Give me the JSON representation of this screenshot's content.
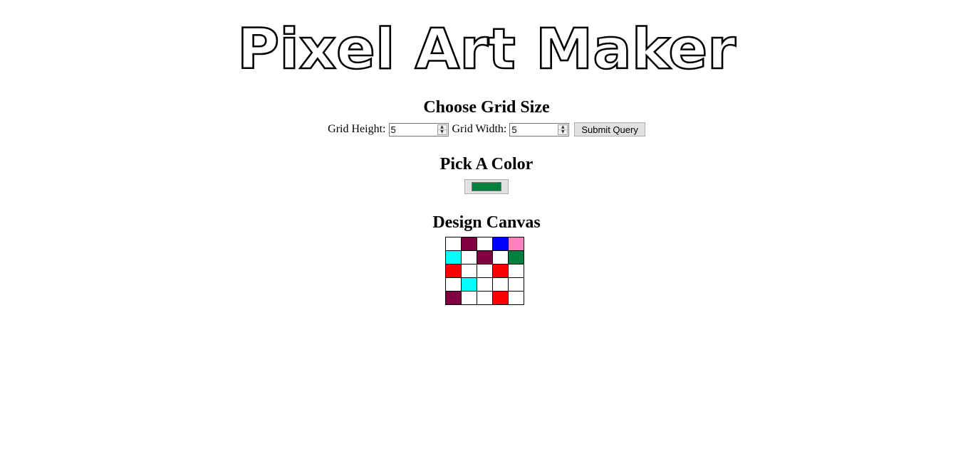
{
  "title": "Pixel Art Maker",
  "grid_section": {
    "heading": "Choose Grid Size",
    "height_label": "Grid Height:",
    "height_value": "5",
    "width_label": "Grid Width:",
    "width_value": "5",
    "submit_label": "Submit Query"
  },
  "color_section": {
    "heading": "Pick A Color",
    "selected_color": "#008040"
  },
  "canvas_section": {
    "heading": "Design Canvas",
    "rows": [
      [
        "#ffffff",
        "#800040",
        "#ffffff",
        "#0000ff",
        "#ff80c0"
      ],
      [
        "#00ffff",
        "#ffffff",
        "#800040",
        "#ffffff",
        "#008040"
      ],
      [
        "#ff0000",
        "#ffffff",
        "#ffffff",
        "#ff0000",
        "#ffffff"
      ],
      [
        "#ffffff",
        "#00ffff",
        "#ffffff",
        "#ffffff",
        "#ffffff"
      ],
      [
        "#800040",
        "#ffffff",
        "#ffffff",
        "#ff0000",
        "#ffffff"
      ]
    ]
  }
}
